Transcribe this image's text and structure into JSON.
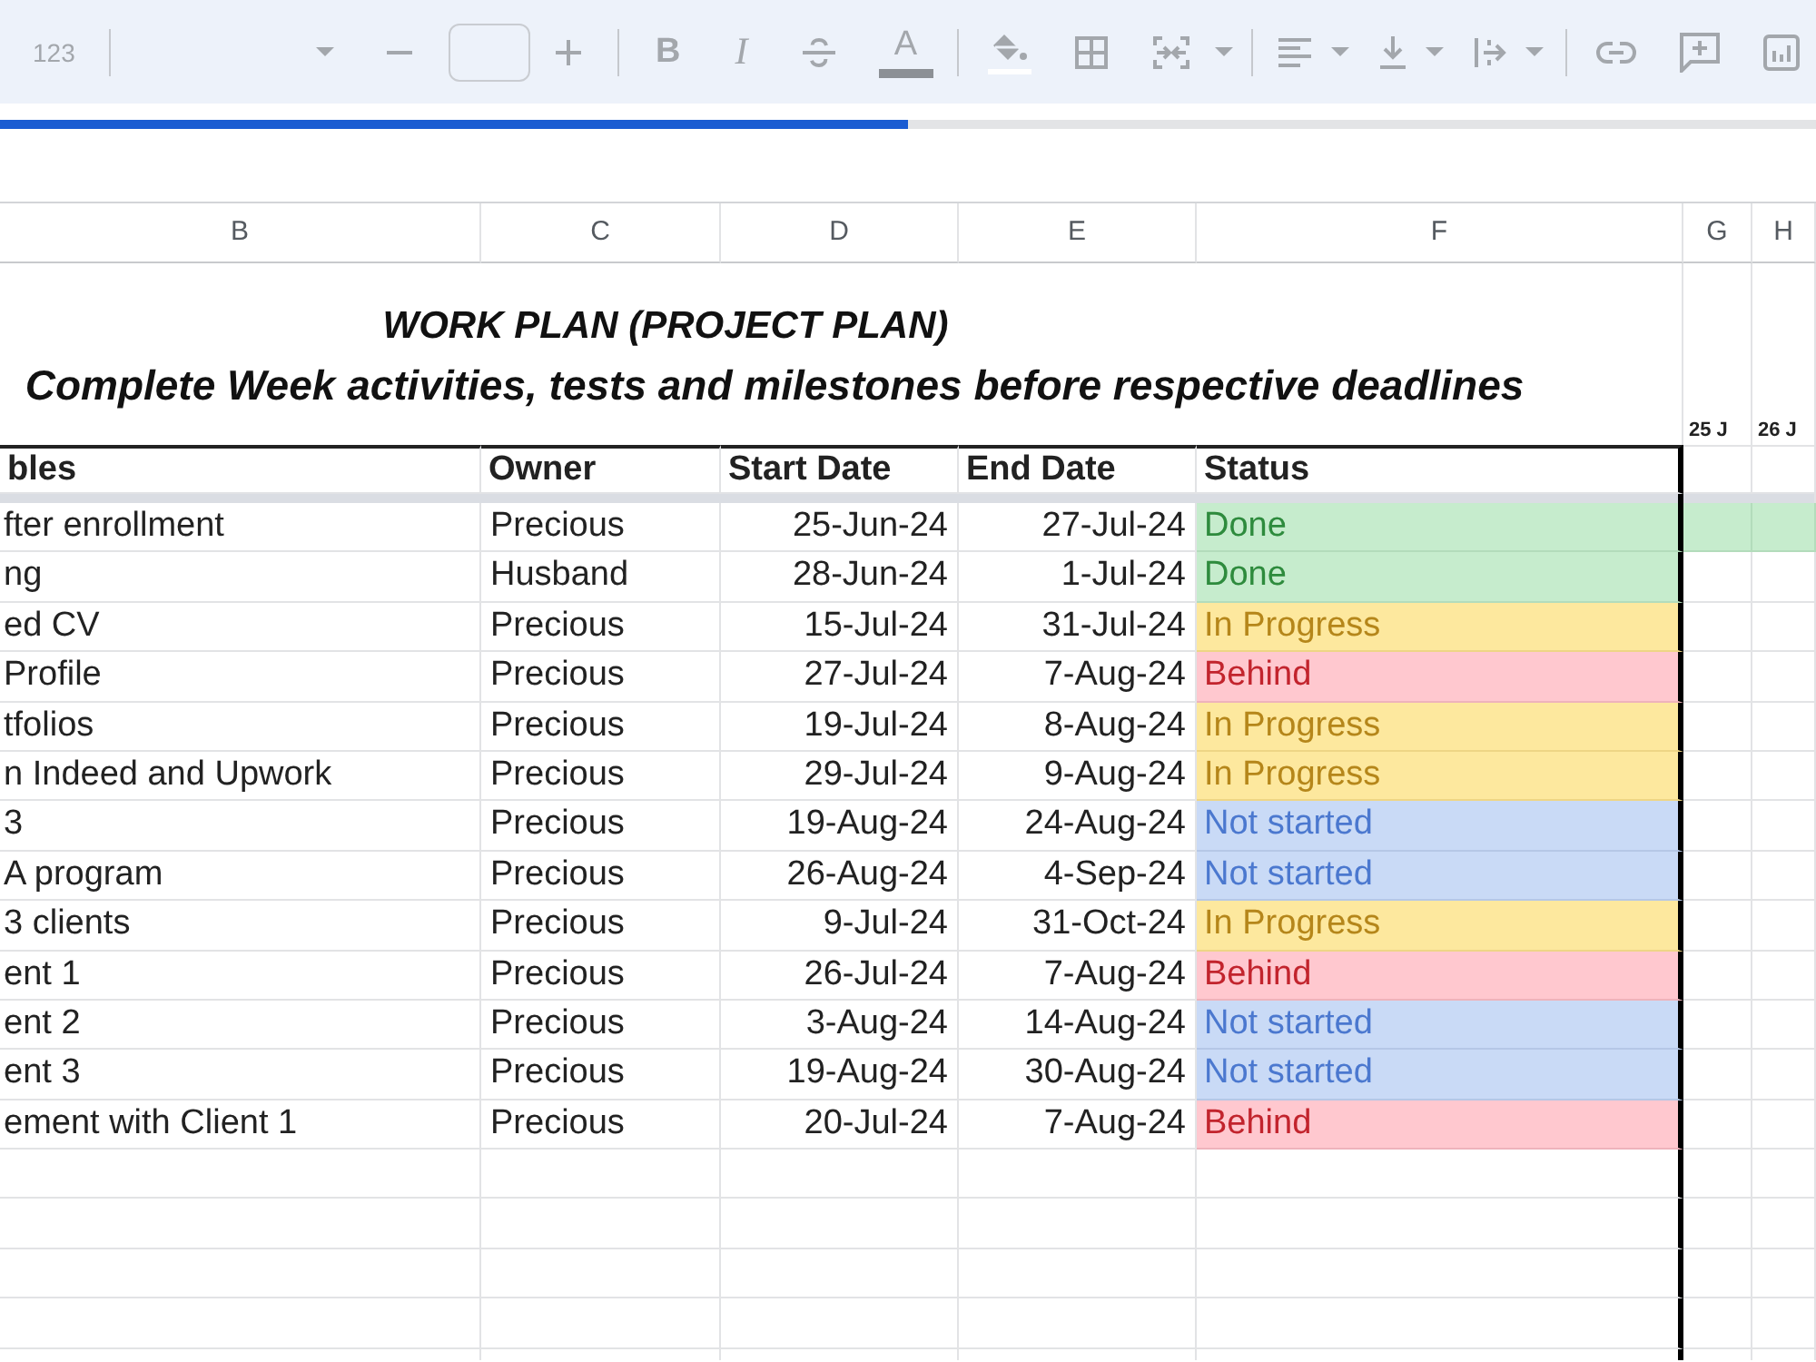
{
  "toolbar": {
    "number_format": "123",
    "bold": "B",
    "italic": "I",
    "text_color": "A"
  },
  "loading_bar": {
    "level": 0.5
  },
  "sheet": {
    "columns": [
      "B",
      "C",
      "D",
      "E",
      "F",
      "G",
      "H"
    ],
    "title": "WORK PLAN (PROJECT PLAN)",
    "subtitle": "Complete Week activities, tests and milestones before respective deadlines",
    "timeline_dates": [
      "25 J",
      "26 J"
    ],
    "header": [
      "bles",
      "Owner",
      "Start Date",
      "End Date",
      "Status"
    ],
    "rows": [
      {
        "task": "fter enrollment",
        "owner": "Precious",
        "start": "25-Jun-24",
        "end": "27-Jul-24",
        "status": "Done",
        "kind": "done",
        "timeline": [
          {
            "filled": true
          },
          {
            "filled": true
          }
        ]
      },
      {
        "task": "ng",
        "owner": "Husband",
        "start": "28-Jun-24",
        "end": "1-Jul-24",
        "status": "Done",
        "kind": "done",
        "timeline": [
          {
            "filled": false
          },
          {
            "filled": false
          }
        ]
      },
      {
        "task": "ed CV",
        "owner": "Precious",
        "start": "15-Jul-24",
        "end": "31-Jul-24",
        "status": "In Progress",
        "kind": "in_progress",
        "timeline": [
          {
            "filled": false
          },
          {
            "filled": false
          }
        ]
      },
      {
        "task": "Profile",
        "owner": "Precious",
        "start": "27-Jul-24",
        "end": "7-Aug-24",
        "status": "Behind",
        "kind": "behind",
        "timeline": [
          {
            "filled": false
          },
          {
            "filled": false
          }
        ]
      },
      {
        "task": "tfolios",
        "owner": "Precious",
        "start": "19-Jul-24",
        "end": "8-Aug-24",
        "status": "In Progress",
        "kind": "in_progress",
        "timeline": [
          {
            "filled": false
          },
          {
            "filled": false
          }
        ]
      },
      {
        "task": "n Indeed and Upwork",
        "owner": "Precious",
        "start": "29-Jul-24",
        "end": "9-Aug-24",
        "status": "In Progress",
        "kind": "in_progress",
        "timeline": [
          {
            "filled": false
          },
          {
            "filled": false
          }
        ]
      },
      {
        "task": "3",
        "owner": "Precious",
        "start": "19-Aug-24",
        "end": "24-Aug-24",
        "status": "Not started",
        "kind": "not_started",
        "timeline": [
          {
            "filled": false
          },
          {
            "filled": false
          }
        ]
      },
      {
        "task": "A program",
        "owner": "Precious",
        "start": "26-Aug-24",
        "end": "4-Sep-24",
        "status": "Not started",
        "kind": "not_started",
        "timeline": [
          {
            "filled": false
          },
          {
            "filled": false
          }
        ]
      },
      {
        "task": "3 clients",
        "owner": "Precious",
        "start": "9-Jul-24",
        "end": "31-Oct-24",
        "status": "In Progress",
        "kind": "in_progress",
        "timeline": [
          {
            "filled": false
          },
          {
            "filled": false
          }
        ]
      },
      {
        "task": "ent 1",
        "owner": "Precious",
        "start": "26-Jul-24",
        "end": "7-Aug-24",
        "status": "Behind",
        "kind": "behind",
        "timeline": [
          {
            "filled": false
          },
          {
            "filled": false
          }
        ]
      },
      {
        "task": "ent 2",
        "owner": "Precious",
        "start": "3-Aug-24",
        "end": "14-Aug-24",
        "status": "Not started",
        "kind": "not_started",
        "timeline": [
          {
            "filled": false
          },
          {
            "filled": false
          }
        ]
      },
      {
        "task": "ent 3",
        "owner": "Precious",
        "start": "19-Aug-24",
        "end": "30-Aug-24",
        "status": "Not started",
        "kind": "not_started",
        "timeline": [
          {
            "filled": false
          },
          {
            "filled": false
          }
        ]
      },
      {
        "task": "ement with Client 1",
        "owner": "Precious",
        "start": "20-Jul-24",
        "end": "7-Aug-24",
        "status": "Behind",
        "kind": "behind",
        "timeline": [
          {
            "filled": false
          },
          {
            "filled": false
          }
        ]
      }
    ]
  }
}
